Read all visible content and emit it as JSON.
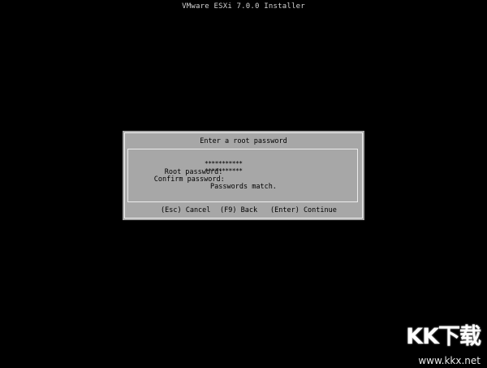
{
  "window": {
    "title": "VMware ESXi 7.0.0 Installer"
  },
  "dialog": {
    "title": "Enter a root password",
    "fields": [
      {
        "label": "Root password:",
        "value": "***********"
      },
      {
        "label": "Confirm password:",
        "value": "***********"
      }
    ],
    "status": "Passwords match.",
    "actions": {
      "cancel": "(Esc) Cancel",
      "back": "(F9) Back",
      "continue": "(Enter) Continue"
    }
  },
  "watermark": {
    "logo": "KK下载",
    "url": "www.kkx.net"
  },
  "colors": {
    "background": "#000000",
    "dialog": "#a7a7a7",
    "frame": "#f2f2f2",
    "title_text": "#d2d2d2",
    "dialog_text": "#000000"
  }
}
